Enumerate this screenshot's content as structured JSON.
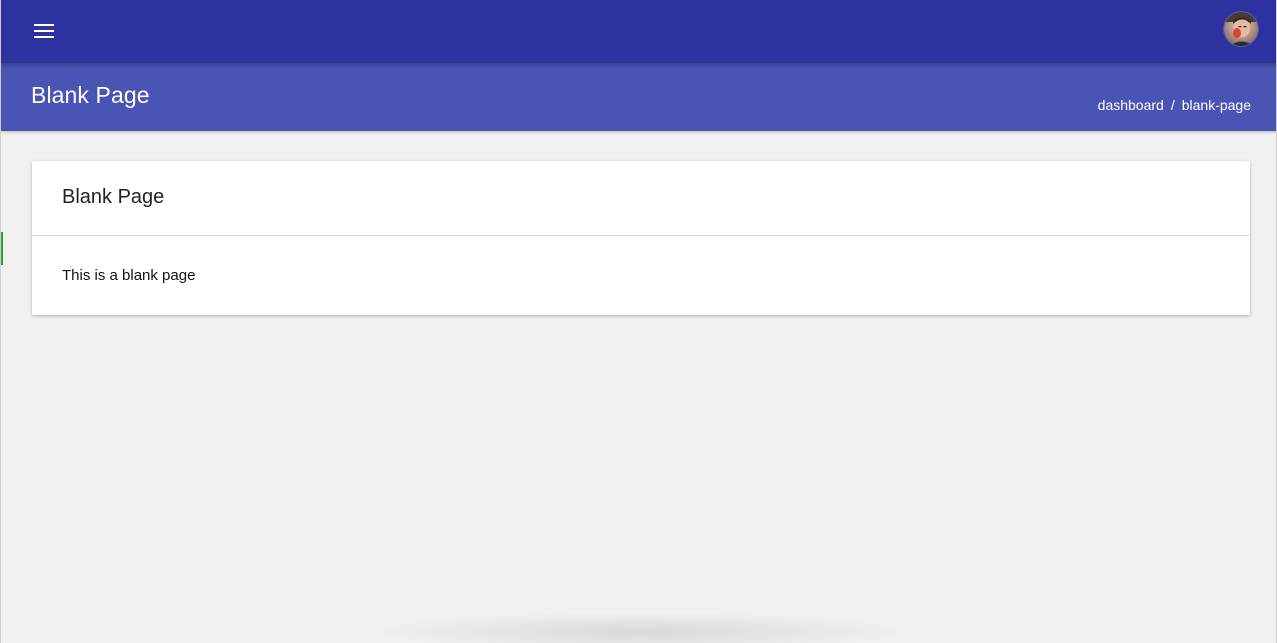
{
  "toolbar": {
    "background": "#2c32a0",
    "menu_icon": "hamburger-menu-icon",
    "avatar_icon": "user-avatar"
  },
  "header": {
    "background": "#4a54b4",
    "title": "Blank Page",
    "breadcrumb": [
      {
        "label": "dashboard"
      },
      {
        "label": "blank-page"
      }
    ],
    "breadcrumb_separator": "/"
  },
  "card": {
    "title": "Blank Page",
    "body": "This is a blank page"
  },
  "colors": {
    "page_background": "#f1f1f1",
    "card_background": "#ffffff",
    "accent_marker": "#2e9e3a"
  }
}
